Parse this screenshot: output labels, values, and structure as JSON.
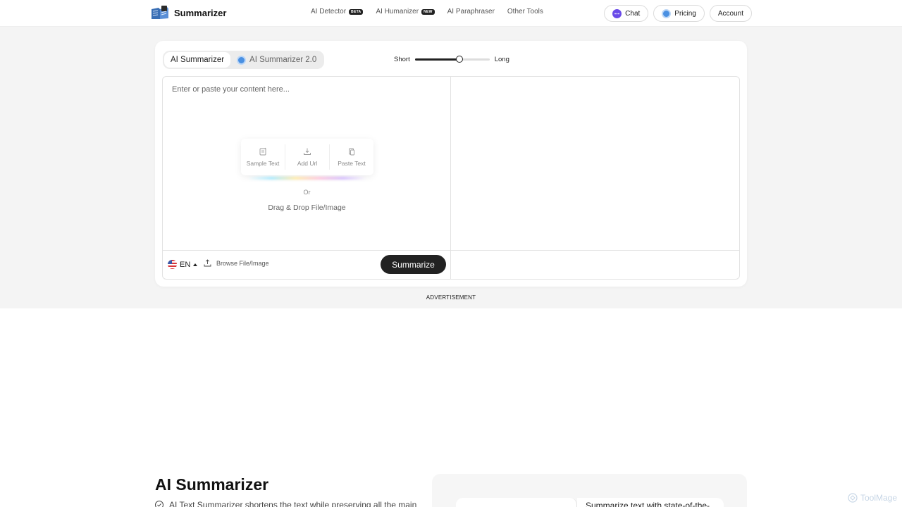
{
  "header": {
    "logo_text": "Summarizer",
    "nav": [
      {
        "label": "AI Detector",
        "badge": "BETA"
      },
      {
        "label": "AI Humanizer",
        "badge": "NEW"
      },
      {
        "label": "AI Paraphraser"
      },
      {
        "label": "Other Tools"
      }
    ],
    "buttons": {
      "chat": "Chat",
      "pricing": "Pricing",
      "account": "Account"
    }
  },
  "tool": {
    "tabs": [
      {
        "label": "AI Summarizer",
        "active": true
      },
      {
        "label": "AI Summarizer 2.0",
        "active": false
      }
    ],
    "length": {
      "min_label": "Short",
      "max_label": "Long",
      "value": 0.6
    },
    "input": {
      "placeholder": "Enter or paste your content here..."
    },
    "actions": [
      "Sample Text",
      "Add Url",
      "Paste Text"
    ],
    "or_text": "Or",
    "drop_text": "Drag & Drop File/Image",
    "language": "EN",
    "browse_label": "Browse File/Image",
    "submit_label": "Summarize"
  },
  "ad_label": "ADVERTISEMENT",
  "section": {
    "title": "AI Summarizer",
    "line": "AI Text Summarizer shortens the text while preserving all the main",
    "feature_text": "Summarize text with state-of-the-"
  },
  "watermark": "ToolMage",
  "colors": {
    "primary_button": "#222222",
    "band": "#f4f4f4",
    "accent": "#4a90e2",
    "chat_icon": "#6a4be8"
  }
}
